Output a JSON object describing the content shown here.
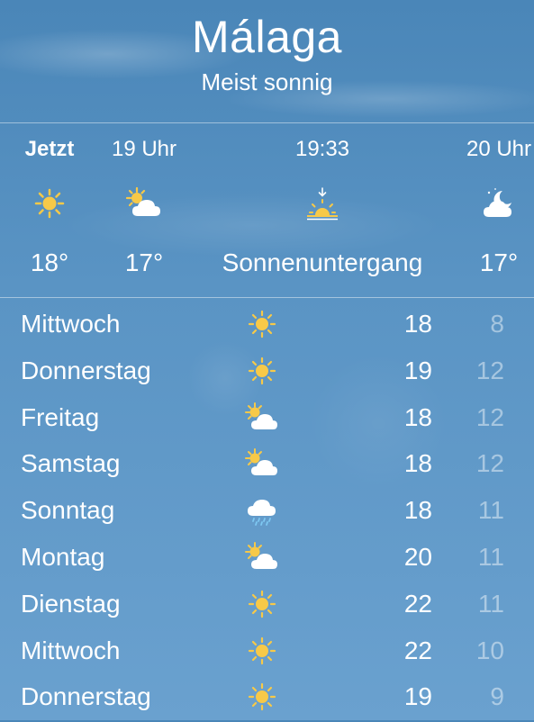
{
  "header": {
    "city": "Málaga",
    "condition": "Meist sonnig"
  },
  "hourly": [
    {
      "time": "Jetzt",
      "icon": "sun-icon",
      "temp": "18°"
    },
    {
      "time": "19 Uhr",
      "icon": "partly-cloudy-icon",
      "temp": "17°"
    },
    {
      "time": "19:33",
      "icon": "sunset-icon",
      "temp": "Sonnenuntergang"
    },
    {
      "time": "20 Uhr",
      "icon": "moon-cloud-icon",
      "temp": "17°"
    }
  ],
  "daily": [
    {
      "day": "Mittwoch",
      "icon": "sun-icon",
      "max": "18",
      "min": "8"
    },
    {
      "day": "Donnerstag",
      "icon": "sun-icon",
      "max": "19",
      "min": "12"
    },
    {
      "day": "Freitag",
      "icon": "partly-cloudy-icon",
      "max": "18",
      "min": "12"
    },
    {
      "day": "Samstag",
      "icon": "partly-cloudy-icon",
      "max": "18",
      "min": "12"
    },
    {
      "day": "Sonntag",
      "icon": "rain-cloud-icon",
      "max": "18",
      "min": "11"
    },
    {
      "day": "Montag",
      "icon": "partly-cloudy-icon",
      "max": "20",
      "min": "11"
    },
    {
      "day": "Dienstag",
      "icon": "sun-icon",
      "max": "22",
      "min": "11"
    },
    {
      "day": "Mittwoch",
      "icon": "sun-icon",
      "max": "22",
      "min": "10"
    },
    {
      "day": "Donnerstag",
      "icon": "sun-icon",
      "max": "19",
      "min": "9"
    }
  ],
  "colors": {
    "sun": "#f7c948",
    "cloud": "#ffffff",
    "divider": "rgba(255,255,255,0.45)"
  }
}
